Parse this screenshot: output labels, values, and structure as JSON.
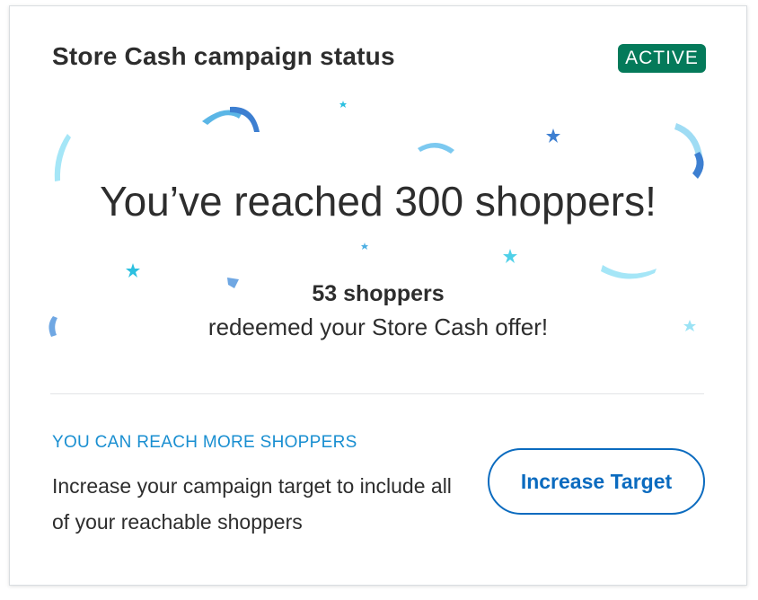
{
  "card": {
    "title": "Store Cash campaign status",
    "status_badge": "ACTIVE",
    "headline": "You’ve reached 300 shoppers!",
    "redeemed_count": "53 shoppers",
    "redeemed_text": "redeemed your Store Cash offer!",
    "reach_label": "YOU CAN REACH MORE SHOPPERS",
    "reach_description": "Increase your campaign target to include all of your reachable shoppers",
    "increase_button_label": "Increase Target"
  },
  "colors": {
    "badge_bg": "#047a5a",
    "accent_blue": "#0b6bbf",
    "label_blue": "#1a8fd1",
    "confetti_light": "#9be3f5",
    "confetti_mid": "#4fb0e3",
    "confetti_dark": "#3d7fd1"
  },
  "icons": {
    "confetti": "confetti-decoration"
  }
}
